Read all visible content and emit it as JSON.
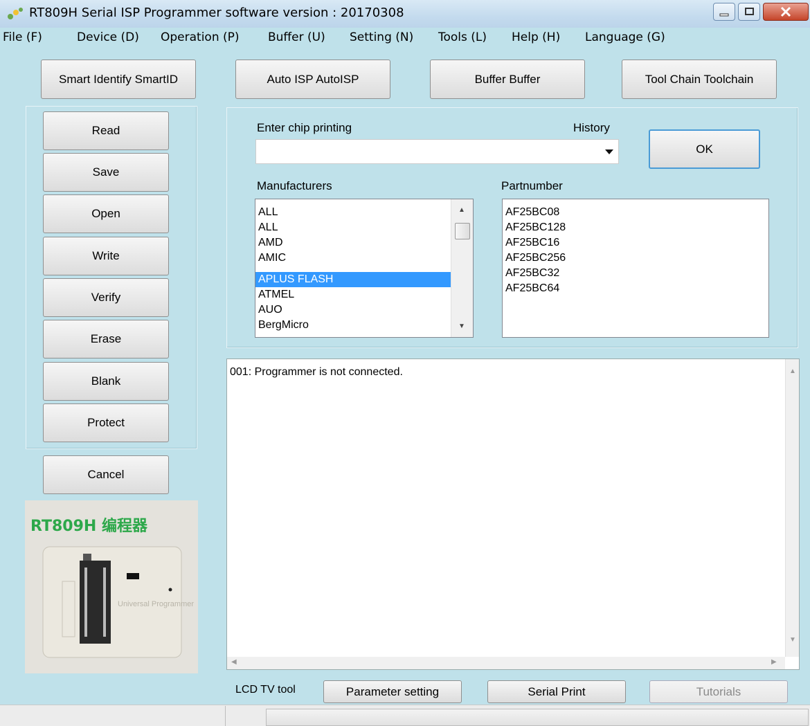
{
  "window": {
    "title": "RT809H Serial ISP Programmer software version : 20170308",
    "colors": {
      "background": "#bfe1ea",
      "selection": "#3399ff",
      "brand_green": "#2da84a",
      "close_red": "#c5452a"
    }
  },
  "menu": [
    "File (F)",
    "Device (D)",
    "Operation (P)",
    "Buffer (U)",
    "Setting (N)",
    "Tools (L)",
    "Help (H)",
    "Language (G)"
  ],
  "toolbar": {
    "smart_identify": "Smart Identify SmartID",
    "auto_isp": "Auto ISP AutoISP",
    "buffer": "Buffer Buffer",
    "tool_chain": "Tool Chain Toolchain"
  },
  "actions": [
    "Read",
    "Save",
    "Open",
    "Write",
    "Verify",
    "Erase",
    "Blank",
    "Protect"
  ],
  "cancel": "Cancel",
  "device_image": {
    "title": "RT809H 编程器",
    "caption": "Universal Programmer"
  },
  "chip": {
    "label": "Enter chip printing",
    "history_label": "History",
    "input_value": "",
    "ok": "OK"
  },
  "manufacturers": {
    "label": "Manufacturers",
    "items": [
      "ALL",
      "ALL",
      "AMD",
      "AMIC",
      "APLUS FLASH",
      "ATMEL",
      "AUO",
      "BergMicro"
    ],
    "selected": "APLUS FLASH"
  },
  "partnumber": {
    "label": "Partnumber",
    "items": [
      "AF25BC08",
      "AF25BC128",
      "AF25BC16",
      "AF25BC256",
      "AF25BC32",
      "AF25BC64"
    ]
  },
  "log": [
    "001:  Programmer is not connected."
  ],
  "bottom": {
    "lcd_label": "LCD TV tool",
    "parameter_setting": "Parameter setting",
    "serial_print": "Serial Print",
    "tutorials": "Tutorials"
  },
  "icons": [
    "app-icon",
    "minimize-icon",
    "maximize-icon",
    "close-icon",
    "dropdown-arrow-icon",
    "scroll-up-icon",
    "scroll-down-icon",
    "scroll-left-icon",
    "scroll-right-icon"
  ]
}
